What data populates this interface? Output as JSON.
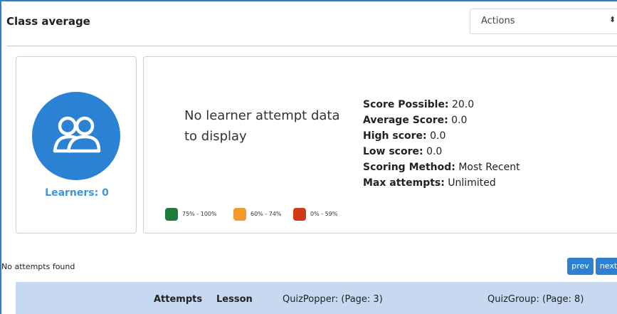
{
  "header": {
    "title": "Class average",
    "actions": {
      "selected": "Actions",
      "caret": "⬍"
    }
  },
  "learners": {
    "label": "Learners: 0",
    "icon": "users-icon",
    "color": "#2b82d4"
  },
  "summary": {
    "empty_message": "No learner attempt data to display",
    "legend": [
      {
        "label": "75% - 100%",
        "color": "#1e7a3a"
      },
      {
        "label": "60% - 74%",
        "color": "#f39a2b"
      },
      {
        "label": "0% - 59%",
        "color": "#d03a17"
      }
    ],
    "stats": [
      {
        "label": "Score Possible:",
        "value": "20.0"
      },
      {
        "label": "Average Score:",
        "value": "0.0"
      },
      {
        "label": "High score:",
        "value": "0.0"
      },
      {
        "label": "Low score:",
        "value": "0.0"
      },
      {
        "label": "Scoring Method:",
        "value": "Most Recent"
      },
      {
        "label": "Max attempts:",
        "value": "Unlimited"
      }
    ]
  },
  "attempts": {
    "empty_message": "No attempts found",
    "prev_label": "prev",
    "next_label": "next"
  },
  "table": {
    "columns": [
      "Attempts",
      "Lesson",
      "QuizPopper: (Page: 3)",
      "QuizGroup: (Page: 8)"
    ],
    "header_color": "#c6d9f0"
  }
}
